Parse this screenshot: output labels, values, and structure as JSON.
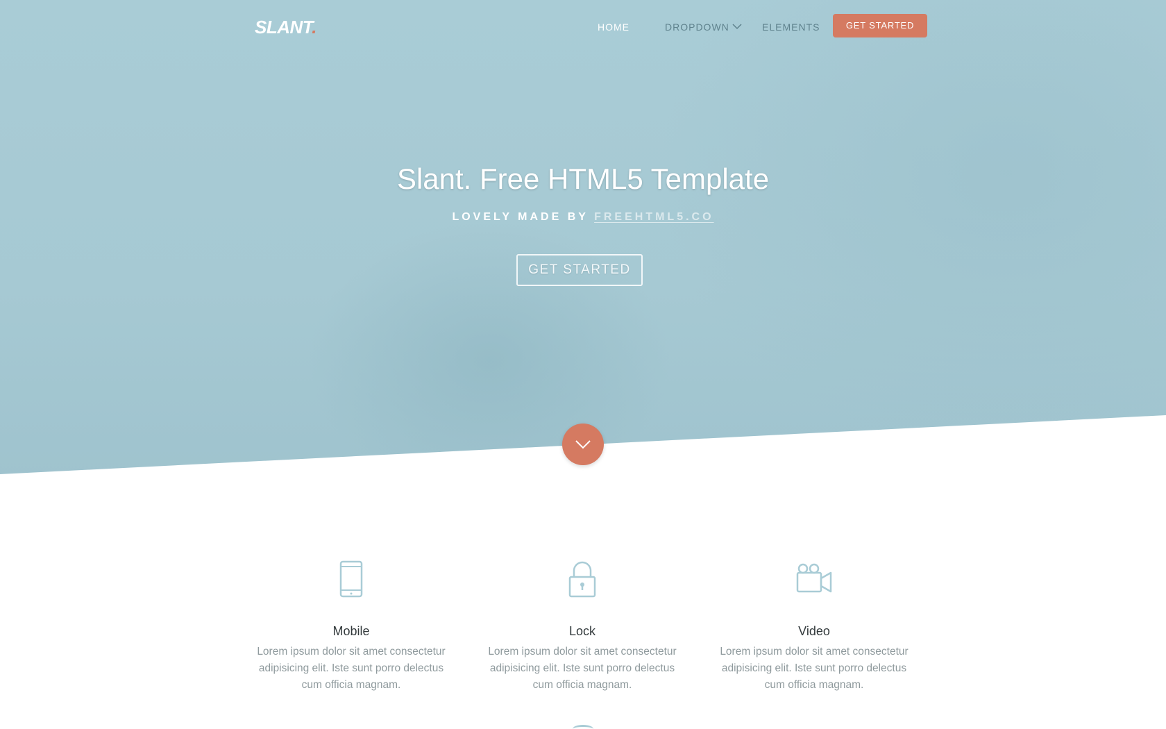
{
  "nav": {
    "logo_text": "SLANT",
    "logo_dot": ".",
    "links": {
      "home": "HOME",
      "dropdown": "DROPDOWN",
      "elements": "ELEMENTS"
    },
    "cta": "GET STARTED"
  },
  "hero": {
    "title": "Slant. Free HTML5 Template",
    "subtitle_prefix": "LOVELY MADE BY ",
    "subtitle_link": "FREEHTML5.CO",
    "button": "GET STARTED"
  },
  "features": [
    {
      "icon": "mobile-icon",
      "title": "Mobile",
      "text": "Lorem ipsum dolor sit amet consectetur adipisicing elit. Iste sunt porro delectus cum officia magnam."
    },
    {
      "icon": "lock-icon",
      "title": "Lock",
      "text": "Lorem ipsum dolor sit amet consectetur adipisicing elit. Iste sunt porro delectus cum officia magnam."
    },
    {
      "icon": "video-icon",
      "title": "Video",
      "text": "Lorem ipsum dolor sit amet consectetur adipisicing elit. Iste sunt porro delectus cum officia magnam."
    }
  ],
  "colors": {
    "hero_bg": "#a9ccd6",
    "accent": "#d57a61",
    "icon": "#a9ccd6"
  }
}
